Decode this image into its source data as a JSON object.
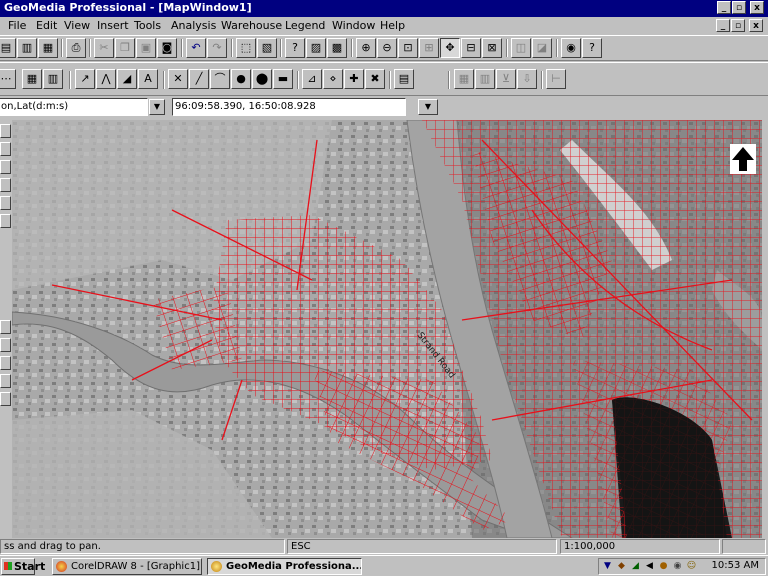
{
  "window": {
    "title": "GeoMedia Professional - [MapWindow1]",
    "minimize_glyph": "_",
    "restore_glyph": "▫",
    "close_glyph": "x"
  },
  "menu": {
    "items": [
      "File",
      "Edit",
      "View",
      "Insert",
      "Tools",
      "Analysis",
      "Warehouse",
      "Legend",
      "Window",
      "Help"
    ]
  },
  "coordinate_readout": {
    "system": "on,Lat(d:m:s)",
    "value": "96:09:58.390, 16:50:08.928"
  },
  "map": {
    "street_label": "Strand Road",
    "north_arrow": "north-arrow-icon",
    "network_color": "#e8101a"
  },
  "status": {
    "prompt": "ss and drag to pan.",
    "key": "ESC",
    "scale": "1:100,000"
  },
  "taskbar": {
    "start_label": "Start",
    "tasks": [
      "CorelDRAW 8 - [Graphic1]",
      "GeoMedia Professiona..."
    ],
    "clock": "10:53 AM"
  }
}
